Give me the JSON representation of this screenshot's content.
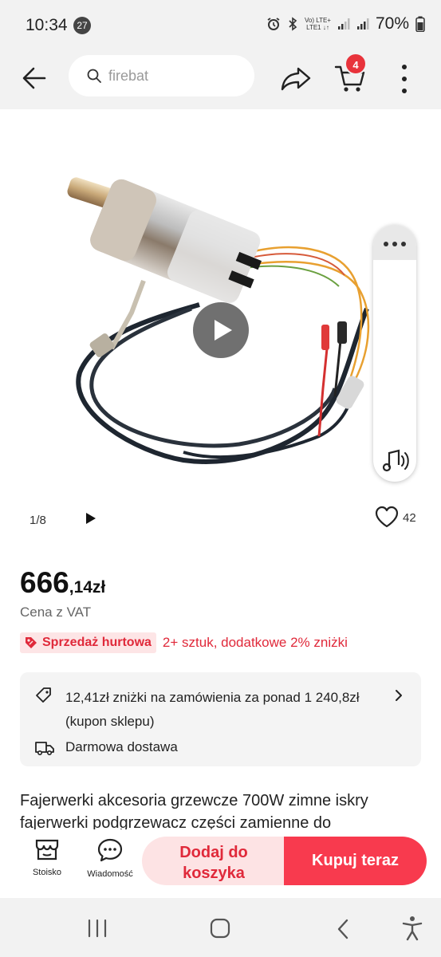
{
  "status_bar": {
    "time": "10:34",
    "notification_count": "27",
    "network_top": "Vo) LTE+",
    "network_bottom": "LTE1 ↓↑",
    "battery": "70%"
  },
  "nav": {
    "search_placeholder": "firebat",
    "cart_count": "4"
  },
  "gallery": {
    "page_indicator": "1/8",
    "likes": "42"
  },
  "price": {
    "integer": "666",
    "fraction": ",14zł",
    "vat_label": "Cena z VAT"
  },
  "wholesale": {
    "badge": "Sprzedaż hurtowa",
    "text": "2+ sztuk, dodatkowe 2% zniżki"
  },
  "info": {
    "coupon_line1": "12,41zł zniżki na zamówienia za ponad 1 240,8zł",
    "coupon_line2": "(kupon sklepu)",
    "delivery": "Darmowa dostawa"
  },
  "product": {
    "title": "Fajerwerki akcesoria grzewcze 700W zimne iskry fajerwerki podgrzewacz części zamienne do"
  },
  "actions": {
    "store_label": "Stoisko",
    "messages_label": "Wiadomość",
    "add_to_cart_line1": "Dodaj do",
    "add_to_cart_line2": "koszyka",
    "buy_now": "Kupuj teraz"
  },
  "colors": {
    "accent": "#f83a4e",
    "accent_light": "#fde3e4",
    "badge_red": "#e8333b"
  }
}
